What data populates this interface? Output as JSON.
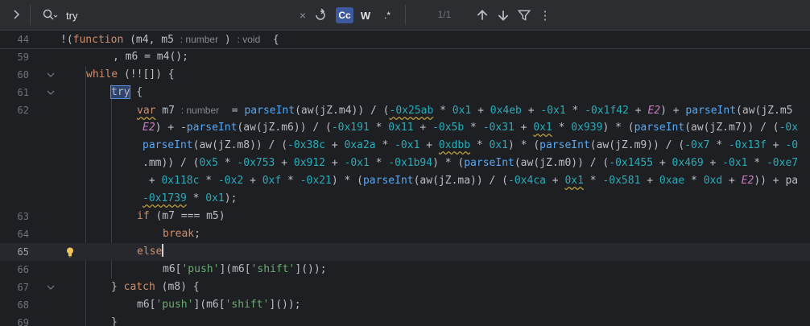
{
  "find_bar": {
    "query": "try",
    "match_count": "1/1",
    "case_label": "Cc",
    "words_label": "W",
    "regex_label": ".*",
    "clear_glyph": "×",
    "more_glyph": "⋮",
    "icons": [
      "chevron-right-icon",
      "search-history-icon",
      "clear-icon",
      "replace-toggle-icon",
      "arrow-up-icon",
      "arrow-down-icon",
      "filter-icon",
      "more-icon"
    ]
  },
  "sticky": {
    "line_number": "44"
  },
  "lines": [
    {
      "n": "59"
    },
    {
      "n": "60"
    },
    {
      "n": "61"
    },
    {
      "n": "62"
    },
    {
      "n": "63"
    },
    {
      "n": "64"
    },
    {
      "n": "65"
    },
    {
      "n": "66"
    },
    {
      "n": "67"
    },
    {
      "n": "68"
    },
    {
      "n": "69"
    }
  ],
  "hints": {
    "number": ": number",
    "void": ": void"
  },
  "colors": {
    "keyword": "#cf8e6d",
    "function": "#56a8f5",
    "number": "#2aacb8",
    "string": "#6aab73",
    "match": "#2e436e",
    "accent": "#3d5a9e"
  }
}
